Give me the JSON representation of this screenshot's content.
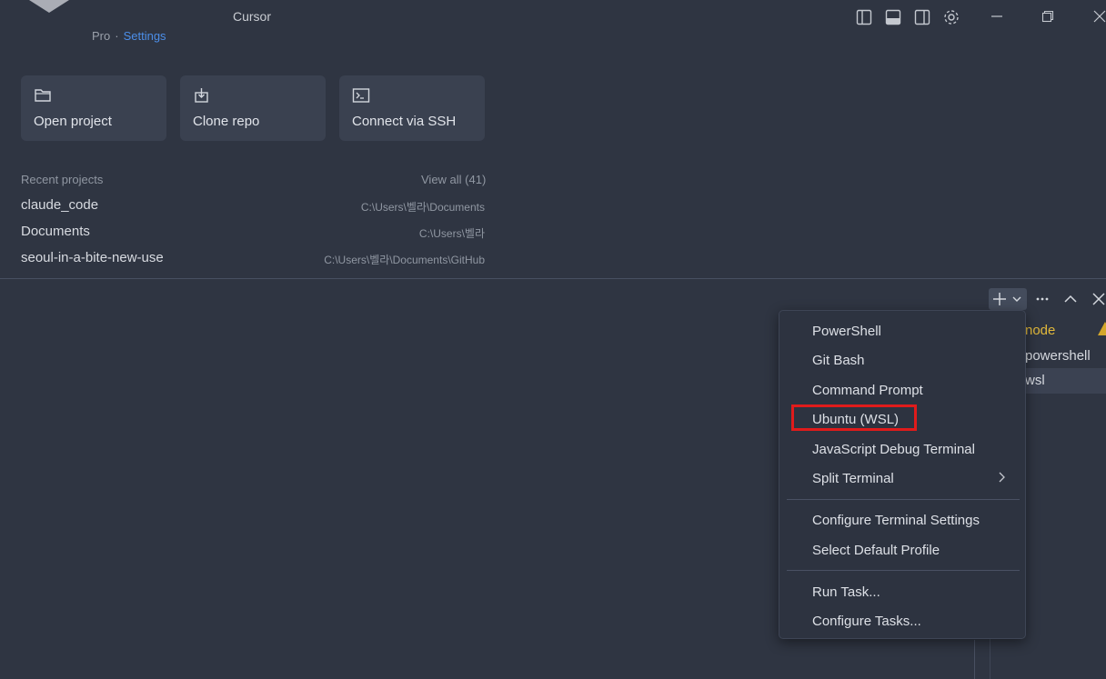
{
  "app": {
    "title": "Cursor",
    "plan": "Pro",
    "plan_separator": "·",
    "settings_link": "Settings"
  },
  "titlebar_icons": [
    "toggle-primary-sidebar-icon",
    "toggle-panel-icon",
    "toggle-secondary-sidebar-icon",
    "gear-icon"
  ],
  "window_controls": [
    "minimize-icon",
    "restore-icon",
    "close-icon"
  ],
  "actions": [
    {
      "label": "Open project",
      "icon": "folder-icon"
    },
    {
      "label": "Clone repo",
      "icon": "clone-icon"
    },
    {
      "label": "Connect via SSH",
      "icon": "terminal-icon"
    }
  ],
  "recent": {
    "heading": "Recent projects",
    "view_all": "View all (41)",
    "items": [
      {
        "name": "claude_code",
        "path": "C:\\Users\\벨라\\Documents"
      },
      {
        "name": "Documents",
        "path": "C:\\Users\\벨라"
      },
      {
        "name": "seoul-in-a-bite-new-use",
        "path": "C:\\Users\\벨라\\Documents\\GitHub"
      }
    ]
  },
  "terminal_toolbar": [
    "plus-icon",
    "chevron-down-icon",
    "more-icon",
    "chevron-up-icon",
    "close-icon"
  ],
  "terminals": [
    {
      "name": "node",
      "warning": true
    },
    {
      "name": "powershell",
      "warning": false
    },
    {
      "name": "wsl",
      "warning": false
    }
  ],
  "dropdown": {
    "group1": [
      "PowerShell",
      "Git Bash",
      "Command Prompt",
      "Ubuntu (WSL)",
      "JavaScript Debug Terminal",
      "Split Terminal"
    ],
    "group2": [
      "Configure Terminal Settings",
      "Select Default Profile"
    ],
    "group3": [
      "Run Task...",
      "Configure Tasks..."
    ],
    "highlighted": "Ubuntu (WSL)",
    "highlight_color": "#e01b1b"
  },
  "colors": {
    "background": "#2f3542",
    "card": "#3a4150",
    "link": "#4c8ee8",
    "node_label": "#e2b93b"
  }
}
